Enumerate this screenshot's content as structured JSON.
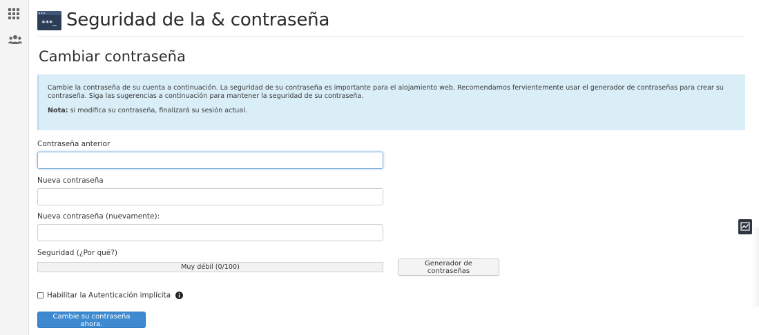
{
  "sidebar": {
    "items": [
      {
        "icon": "apps-grid-icon"
      },
      {
        "icon": "users-icon"
      }
    ]
  },
  "header": {
    "icon": "password-security-icon",
    "title": "Seguridad de la & contraseña"
  },
  "section": {
    "title": "Cambiar contraseña"
  },
  "alert": {
    "text": "Cambie la contraseña de su cuenta a continuación. La seguridad de su contraseña es importante para el alojamiento web. Recomendamos fervientemente usar el generador de contraseñas para crear su contraseña. Siga las sugerencias a continuación para mantener la seguridad de su contraseña.",
    "note_label": "Nota:",
    "note_text": " si modifica su contraseña, finalizará su sesión actual."
  },
  "form": {
    "old_password": {
      "label": "Contraseña anterior",
      "value": ""
    },
    "new_password": {
      "label": "Nueva contraseña",
      "value": ""
    },
    "confirm_password": {
      "label": "Nueva contraseña (nuevamente):",
      "value": ""
    },
    "strength": {
      "label": "Seguridad (¿Por qué?)",
      "text": "Muy débil (0/100)",
      "value": 0
    },
    "generator_button": "Generador de contraseñas",
    "digest_auth": {
      "label": "Habilitar la Autenticación implícita",
      "checked": false
    },
    "submit_button": "Cambie su contraseña ahora."
  },
  "colors": {
    "alert_bg": "#d9eef7",
    "primary_button": "#3d8ad0",
    "strength_weak": "#d9534f"
  }
}
